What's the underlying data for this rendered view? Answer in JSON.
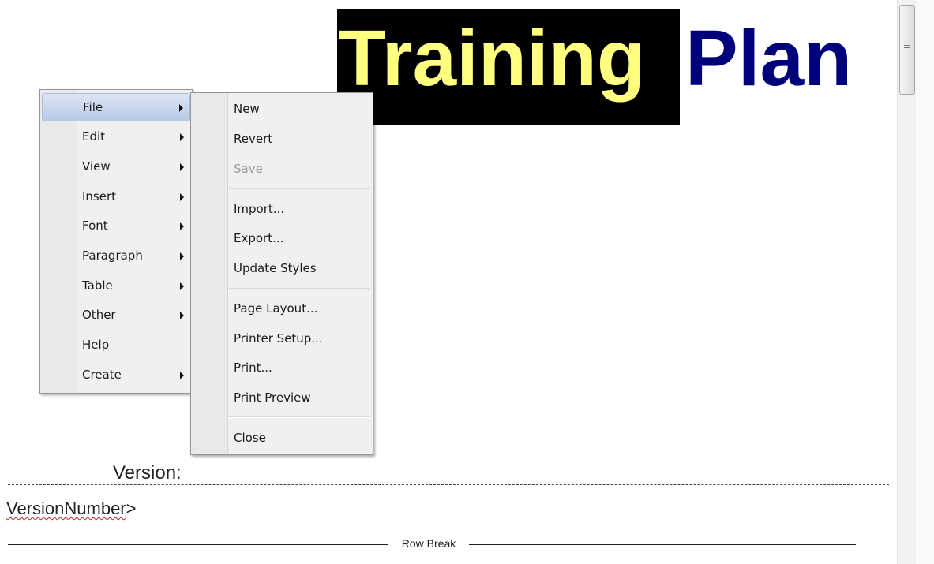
{
  "document": {
    "title_word_1": "Training",
    "title_word_2": "Plan",
    "version_label": "Version:",
    "version_number": "VersionNumber",
    "version_number_suffix": ">",
    "row_break_label": "Row Break"
  },
  "colors": {
    "title_highlight_bg": "#000000",
    "title_word_1": "#ffff80",
    "title_word_2": "#00007a",
    "menu_highlight": "#b8c9e6"
  },
  "context_menu": {
    "items": [
      {
        "label": "File",
        "submenu": true,
        "highlighted": true
      },
      {
        "label": "Edit",
        "submenu": true
      },
      {
        "label": "View",
        "submenu": true
      },
      {
        "label": "Insert",
        "submenu": true
      },
      {
        "label": "Font",
        "submenu": true
      },
      {
        "label": "Paragraph",
        "submenu": true
      },
      {
        "label": "Table",
        "submenu": true
      },
      {
        "label": "Other",
        "submenu": true
      },
      {
        "label": "Help",
        "submenu": false
      },
      {
        "label": "Create",
        "submenu": true
      }
    ]
  },
  "file_submenu": {
    "items": [
      {
        "label": "New"
      },
      {
        "label": "Revert"
      },
      {
        "label": "Save",
        "disabled": true
      },
      {
        "label": "Import..."
      },
      {
        "label": "Export..."
      },
      {
        "label": "Update Styles"
      },
      {
        "label": "Page Layout..."
      },
      {
        "label": "Printer Setup..."
      },
      {
        "label": "Print..."
      },
      {
        "label": "Print Preview"
      },
      {
        "label": "Close"
      }
    ]
  },
  "scrollbar": {
    "grip_icon": "scroll-grip-icon"
  }
}
